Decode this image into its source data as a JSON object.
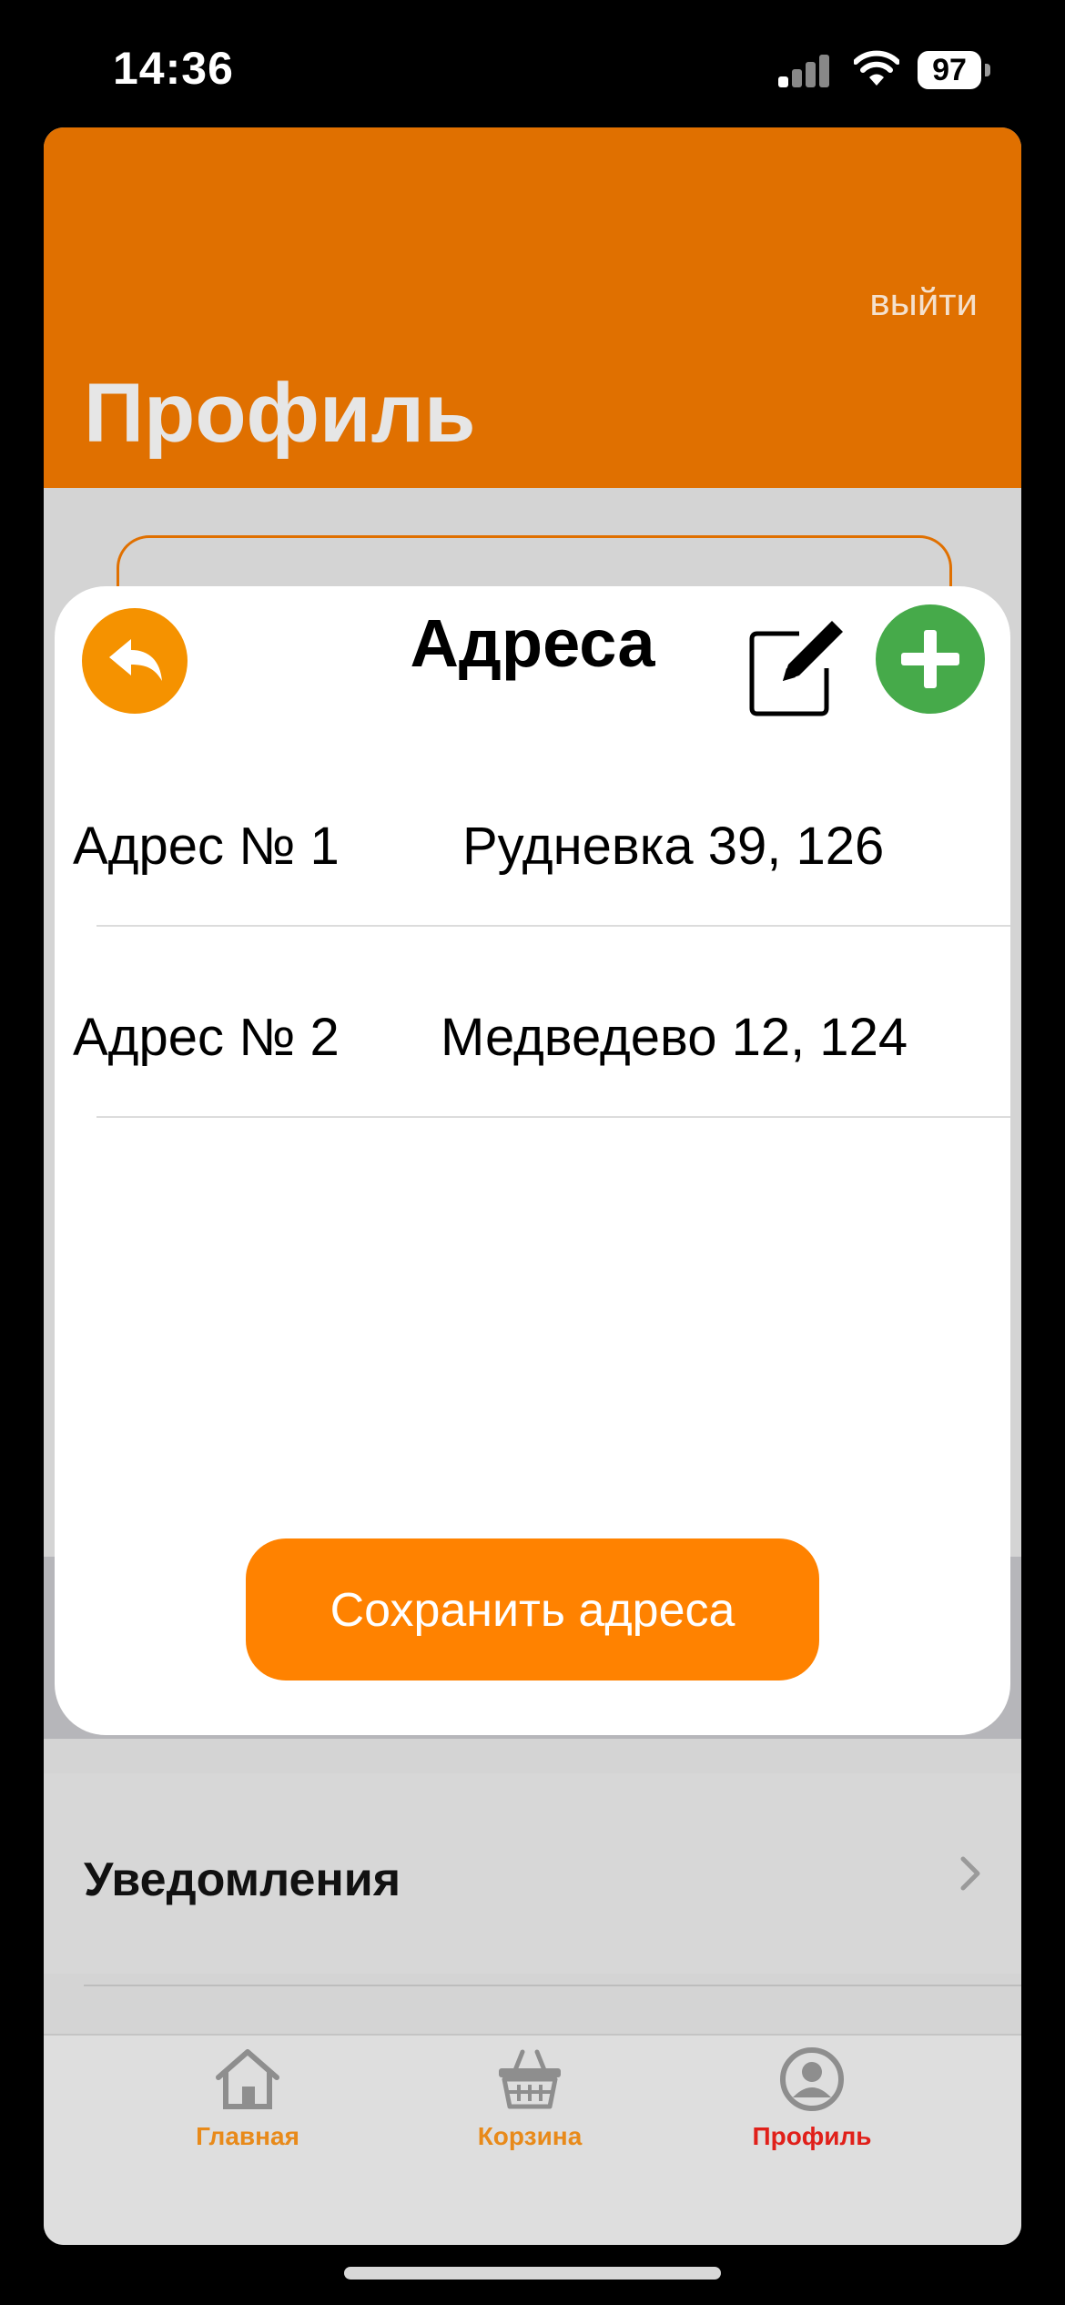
{
  "status_bar": {
    "time": "14:36",
    "battery": "97"
  },
  "header": {
    "title": "Профиль",
    "logout_label": "выйти"
  },
  "modal": {
    "title": "Адреса",
    "addresses": [
      {
        "label": "Адрес № 1",
        "value": "Рудневка 39, 126"
      },
      {
        "label": "Адрес № 2",
        "value": "Медведево 12, 124"
      }
    ],
    "save_label": "Сохранить адреса"
  },
  "settings": {
    "notifications_label": "Уведомления"
  },
  "tabbar": {
    "items": [
      {
        "label": "Главная",
        "icon": "home-icon",
        "active": false
      },
      {
        "label": "Корзина",
        "icon": "basket-icon",
        "active": false
      },
      {
        "label": "Профиль",
        "icon": "profile-icon",
        "active": true
      }
    ]
  },
  "colors": {
    "header_orange": "#e07000",
    "button_orange": "#ff8200",
    "add_green": "#46aa4a",
    "tab_inactive": "#e88a1a",
    "tab_active": "#e0201a"
  }
}
